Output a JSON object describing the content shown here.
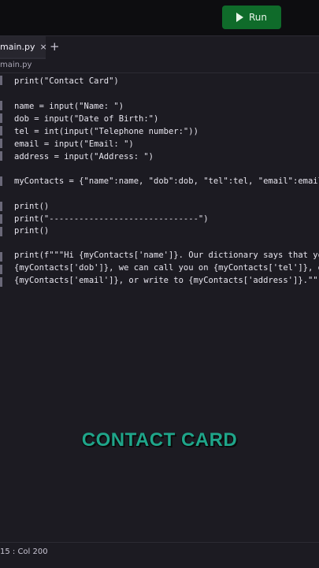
{
  "toolbar": {
    "run_label": "Run",
    "run_icon": "play-icon",
    "accent": "#0f6b2a"
  },
  "tabs": [
    {
      "label": "main.py",
      "close": "×"
    }
  ],
  "add_tab": "+",
  "breadcrumb": "main.py",
  "code_lines": [
    "print(\"Contact Card\")",
    "",
    "name = input(\"Name: \")",
    "dob = input(\"Date of Birth:\")",
    "tel = int(input(\"Telephone number:\"))",
    "email = input(\"Email: \")",
    "address = input(\"Address: \")",
    "",
    "myContacts = {\"name\":name, \"dob\":dob, \"tel\":tel, \"email\":email",
    "",
    "print()",
    "print(\"------------------------------\")",
    "print()",
    "",
    "print(f\"\"\"Hi {myContacts['name']}. Our dictionary says that yo",
    "{myContacts['dob']}, we can call you on {myContacts['tel']}, e",
    "{myContacts['email']}, or write to {myContacts['address']}.\"\"\""
  ],
  "caption": "CONTACT CARD",
  "status": {
    "position": "15 : Col 200"
  }
}
